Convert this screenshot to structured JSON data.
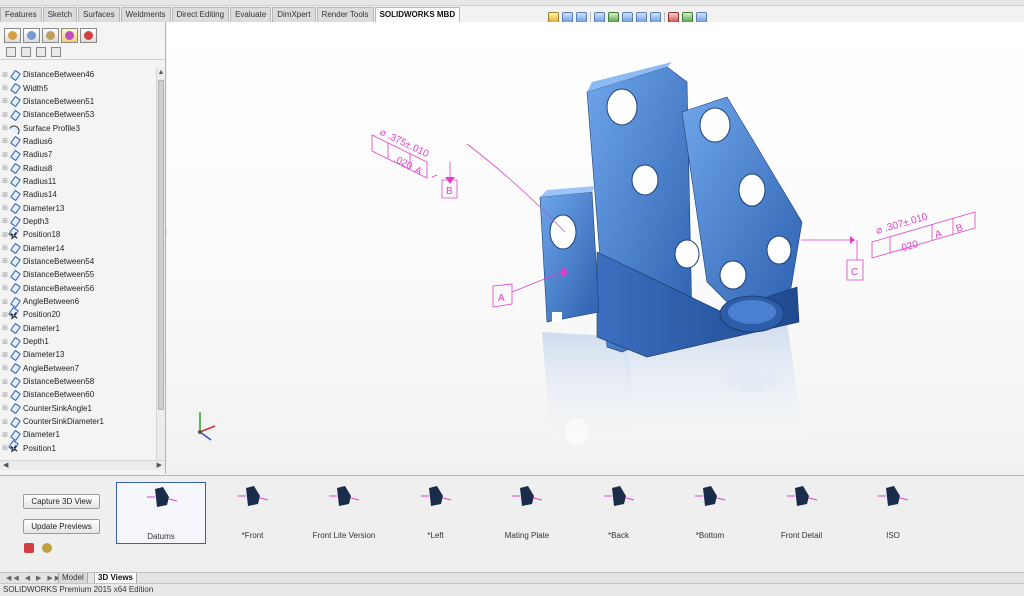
{
  "command_tabs": [
    {
      "label": "Features",
      "active": false
    },
    {
      "label": "Sketch",
      "active": false
    },
    {
      "label": "Surfaces",
      "active": false
    },
    {
      "label": "Weldments",
      "active": false
    },
    {
      "label": "Direct Editing",
      "active": false
    },
    {
      "label": "Evaluate",
      "active": false
    },
    {
      "label": "DimXpert",
      "active": false
    },
    {
      "label": "Render Tools",
      "active": false
    },
    {
      "label": "SOLIDWORKS MBD",
      "active": true
    }
  ],
  "tree": {
    "items": [
      {
        "label": "DistanceBetween46",
        "icon": "dimension-icon"
      },
      {
        "label": "Width5",
        "icon": "dimension-icon"
      },
      {
        "label": "DistanceBetween51",
        "icon": "dimension-icon"
      },
      {
        "label": "DistanceBetween53",
        "icon": "dimension-icon"
      },
      {
        "label": "Surface Profile3",
        "icon": "surface-profile-icon"
      },
      {
        "label": "Radius6",
        "icon": "dimension-icon"
      },
      {
        "label": "Radius7",
        "icon": "dimension-icon"
      },
      {
        "label": "Radius8",
        "icon": "dimension-icon"
      },
      {
        "label": "Radius11",
        "icon": "dimension-icon"
      },
      {
        "label": "Radius14",
        "icon": "dimension-icon"
      },
      {
        "label": "Diameter13",
        "icon": "dimension-icon"
      },
      {
        "label": "Depth3",
        "icon": "dimension-icon"
      },
      {
        "label": "Position18",
        "icon": "position-icon"
      },
      {
        "label": "Diameter14",
        "icon": "dimension-icon"
      },
      {
        "label": "DistanceBetween54",
        "icon": "dimension-icon"
      },
      {
        "label": "DistanceBetween55",
        "icon": "dimension-icon"
      },
      {
        "label": "DistanceBetween56",
        "icon": "dimension-icon"
      },
      {
        "label": "AngleBetween6",
        "icon": "dimension-icon"
      },
      {
        "label": "Position20",
        "icon": "position-icon"
      },
      {
        "label": "Diameter1",
        "icon": "dimension-icon"
      },
      {
        "label": "Depth1",
        "icon": "dimension-icon"
      },
      {
        "label": "Diameter13",
        "icon": "dimension-icon"
      },
      {
        "label": "AngleBetween7",
        "icon": "dimension-icon"
      },
      {
        "label": "DistanceBetween58",
        "icon": "dimension-icon"
      },
      {
        "label": "DistanceBetween60",
        "icon": "dimension-icon"
      },
      {
        "label": "CounterSinkAngle1",
        "icon": "dimension-icon"
      },
      {
        "label": "CounterSinkDiameter1",
        "icon": "dimension-icon"
      },
      {
        "label": "Diameter1",
        "icon": "dimension-icon"
      },
      {
        "label": "Position1",
        "icon": "position-icon"
      }
    ]
  },
  "annotations": {
    "left_dim": "⌀ .375±.010",
    "left_tol": ".020",
    "left_ref": "A",
    "datum_a": "A",
    "datum_b": "B",
    "right_dim": "⌀ .307±.010",
    "right_tol": ".020",
    "right_ref_a": "A",
    "right_ref_b": "B",
    "datum_c": "C"
  },
  "palette": {
    "capture_label": "Capture 3D View",
    "update_label": "Update Previews",
    "views": [
      {
        "label": "Datums",
        "selected": true
      },
      {
        "label": "*Front",
        "selected": false
      },
      {
        "label": "Front Lite Version",
        "selected": false
      },
      {
        "label": "*Left",
        "selected": false
      },
      {
        "label": "Mating Plate",
        "selected": false
      },
      {
        "label": "*Back",
        "selected": false
      },
      {
        "label": "*Bottom",
        "selected": false
      },
      {
        "label": "Front Detail",
        "selected": false
      },
      {
        "label": "ISO",
        "selected": false
      }
    ]
  },
  "bottom_tabs": [
    {
      "label": "Model",
      "active": false
    },
    {
      "label": "3D Views",
      "active": true
    }
  ],
  "status": "SOLIDWORKS Premium 2015 x64 Edition",
  "colors": {
    "part_blue": "#4a86d4",
    "annotation_magenta": "#e040c8",
    "selection_blue": "#3a5fb8"
  }
}
